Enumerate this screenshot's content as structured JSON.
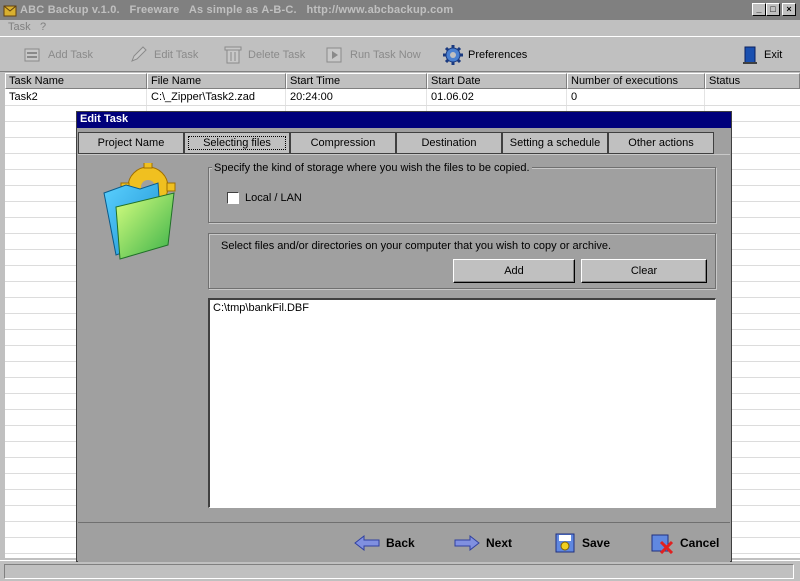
{
  "window": {
    "title": "ABC Backup v.1.0.   Freeware   As simple as A-B-C.   http://www.abcbackup.com",
    "buttons": {
      "minimize": "_",
      "maximize": "□",
      "close": "×"
    }
  },
  "menu": {
    "items": [
      "Task",
      "?"
    ]
  },
  "toolbar": {
    "add_task": "Add Task",
    "edit_task": "Edit Task",
    "delete_task": "Delete Task",
    "run_task_now": "Run Task Now",
    "preferences": "Preferences",
    "exit": "Exit"
  },
  "task_table": {
    "columns": [
      "Task Name",
      "File Name",
      "Start Time",
      "Start Date",
      "Number of executions",
      "Status"
    ],
    "rows": [
      [
        "Task2",
        "C:\\_Zipper\\Task2.zad",
        "20:24:00",
        "01.06.02",
        "0",
        ""
      ]
    ]
  },
  "dialog": {
    "title": "Edit Task",
    "tabs": [
      "Project Name",
      "Selecting files",
      "Compression",
      "Destination",
      "Setting a schedule",
      "Other actions"
    ],
    "active_tab": "Selecting files",
    "storage_group_label": "Specify the kind of storage where you wish the files to be copied.",
    "local_lan_label": "Local / LAN",
    "local_lan_checked": false,
    "select_files_label": "Select files and/or directories on your computer that you wish to copy or archive.",
    "add_button": "Add",
    "clear_button": "Clear",
    "files": [
      "C:\\tmp\\bankFil.DBF"
    ],
    "back_button": "Back",
    "next_button": "Next",
    "save_button": "Save",
    "cancel_button": "Cancel"
  },
  "colors": {
    "dialog_title_bg": "#00007b",
    "face": "#c0c0c0",
    "dialog_body": "#a0a0a0"
  }
}
